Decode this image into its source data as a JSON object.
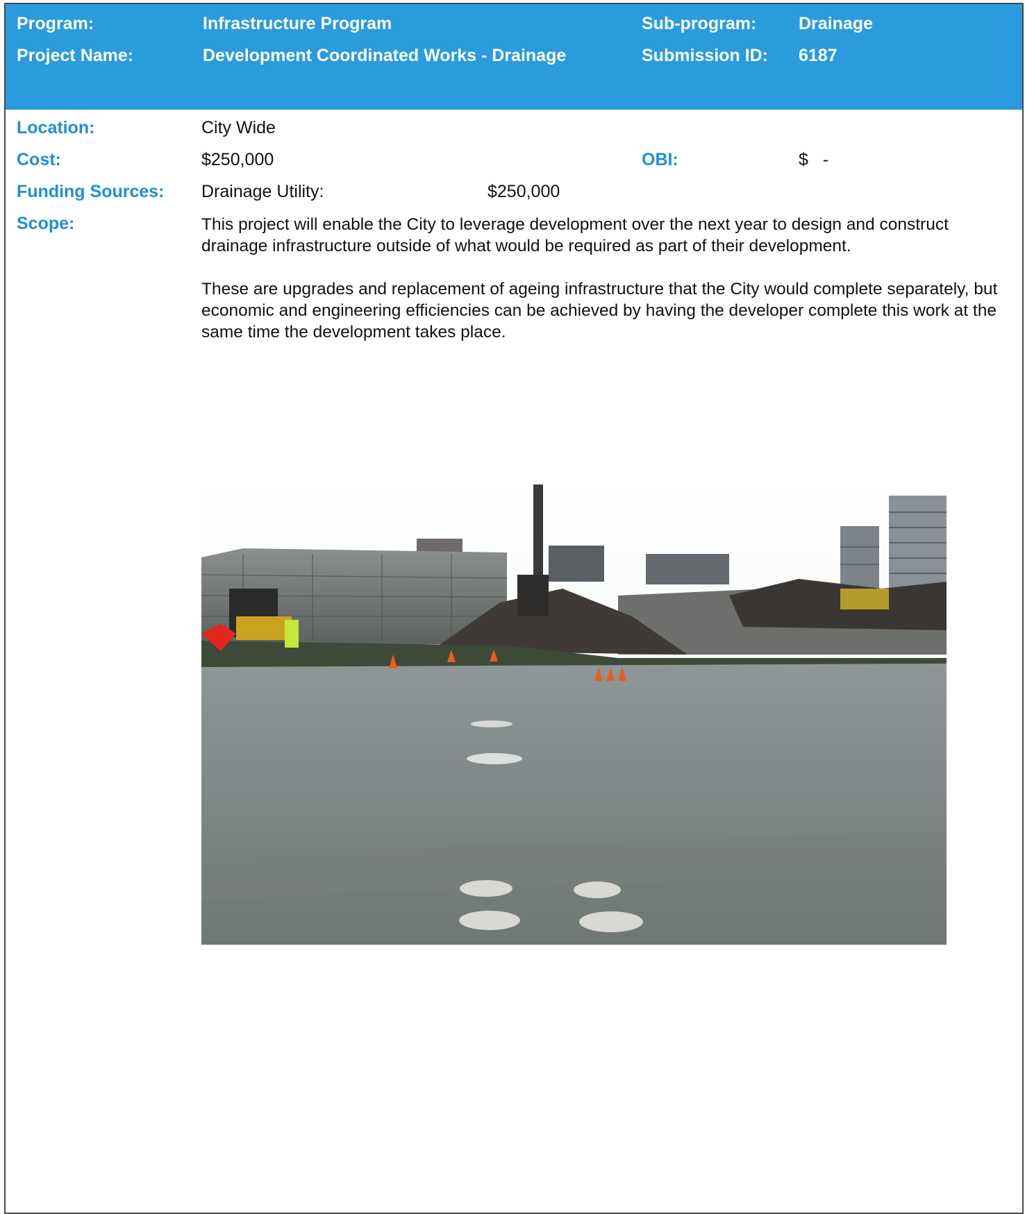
{
  "header": {
    "program_label": "Program:",
    "program_value": "Infrastructure Program",
    "subprogram_label": "Sub-program:",
    "subprogram_value": "Drainage",
    "project_name_label": "Project Name:",
    "project_name_value": "Development Coordinated Works - Drainage",
    "submission_id_label": "Submission ID:",
    "submission_id_value": "6187"
  },
  "details": {
    "location_label": "Location:",
    "location_value": "City Wide",
    "cost_label": "Cost:",
    "cost_value": "$250,000",
    "obi_label": "OBI:",
    "obi_value": "$   -",
    "funding_label": "Funding Sources:",
    "funding_source_name": "Drainage Utility:",
    "funding_source_amount": "$250,000",
    "scope_label": "Scope:",
    "scope_paragraph_1": "This project will enable the City to leverage development over the next year to design and construct drainage infrastructure outside of what would be required as part of their development.",
    "scope_paragraph_2": "These are upgrades and replacement of ageing infrastructure that the City would complete separately, but economic and engineering efficiencies can be achieved by having the developer complete this work at the same time the development takes place."
  },
  "colors": {
    "header_background": "#2a9bdc",
    "label_blue": "#1e8fd6"
  }
}
